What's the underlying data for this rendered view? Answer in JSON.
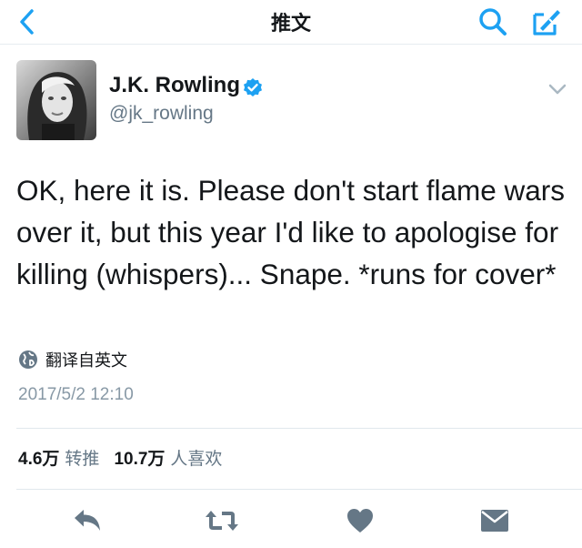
{
  "nav": {
    "title": "推文",
    "back_icon": "chevron-left-icon",
    "search_icon": "search-icon",
    "compose_icon": "compose-icon"
  },
  "author": {
    "name": "J.K. Rowling",
    "handle": "@jk_rowling",
    "verified": true
  },
  "tweet": {
    "text": "OK, here it is. Please don't start flame wars over it, but this year I'd like to apologise for killing (whispers)... Snape. *runs for cover*",
    "translate_label": "翻译自英文",
    "timestamp": "2017/5/2 12:10"
  },
  "stats": {
    "retweet_count": "4.6万",
    "retweet_label": "转推",
    "like_count": "10.7万",
    "like_label": "人喜欢"
  },
  "colors": {
    "accent": "#1da1f2",
    "action_gray": "#657786",
    "text": "#14171a",
    "secondary": "#657786"
  },
  "actions": [
    "reply-icon",
    "retweet-icon",
    "like-icon",
    "direct-message-icon"
  ]
}
